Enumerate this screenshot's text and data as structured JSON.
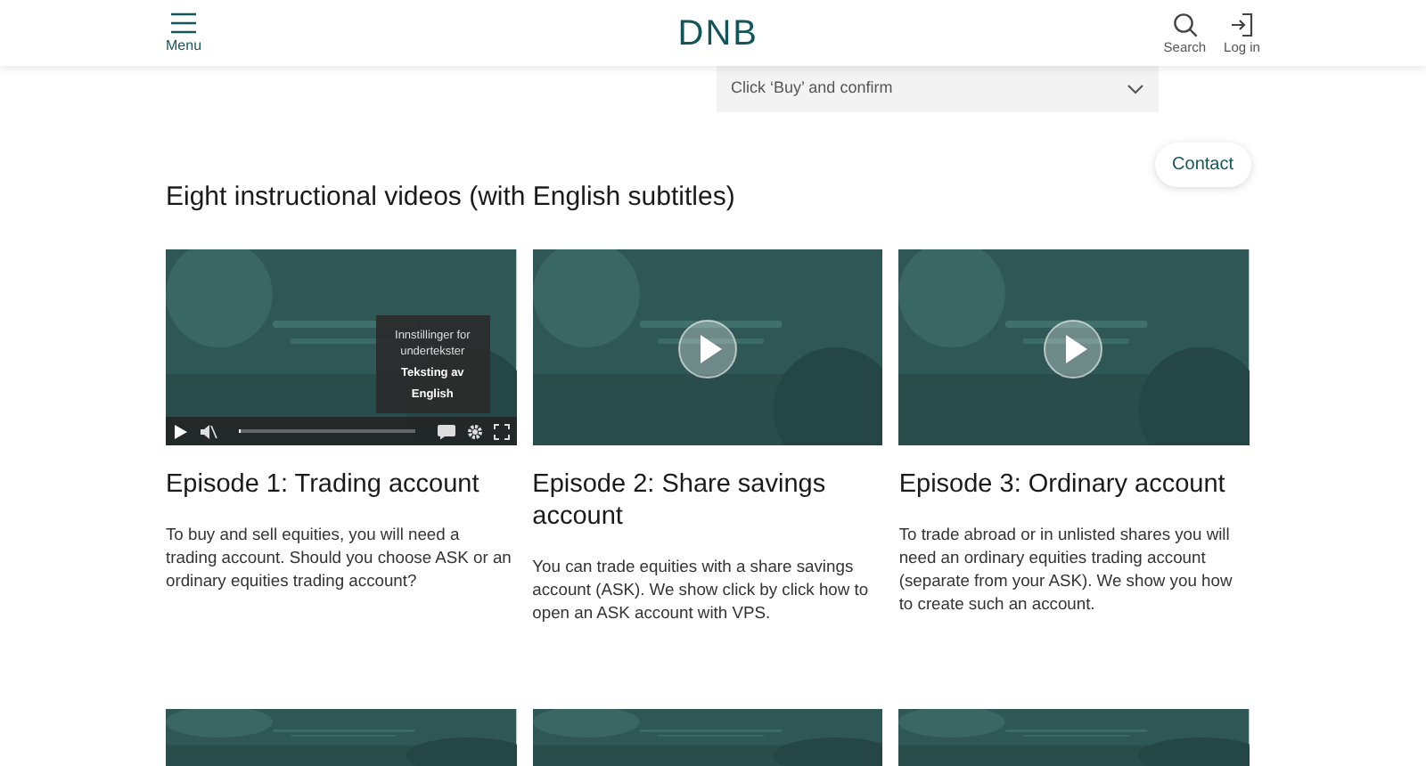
{
  "header": {
    "menu_label": "Menu",
    "logo": "DNB",
    "search_label": "Search",
    "login_label": "Log in"
  },
  "step_dropdown": {
    "label": "Click ‘Buy’ and confirm",
    "expanded": false
  },
  "contact_button": "Contact",
  "section_title": "Eight instructional videos (with English subtitles)",
  "videos": [
    {
      "kind": "player",
      "title": "Episode 1: Trading account",
      "description": "To buy and sell equities, you will need a trading account. Should you choose ASK or an ordinary equities trading account?",
      "subtitle_menu": {
        "heading": "Innstillinger for undertekster",
        "options": [
          "Teksting av",
          "English"
        ]
      },
      "progress": {
        "level": 0.01
      }
    },
    {
      "kind": "poster",
      "title": "Episode 2: Share savings account",
      "description": "You can trade equities with a share savings account (ASK). We show click by click how to open an ASK account with VPS."
    },
    {
      "kind": "poster",
      "title": "Episode 3: Ordinary account",
      "description": "To trade abroad or in unlisted shares you will need an ordinary equities trading account (separate from your ASK). We show you how to create such an account."
    }
  ]
}
